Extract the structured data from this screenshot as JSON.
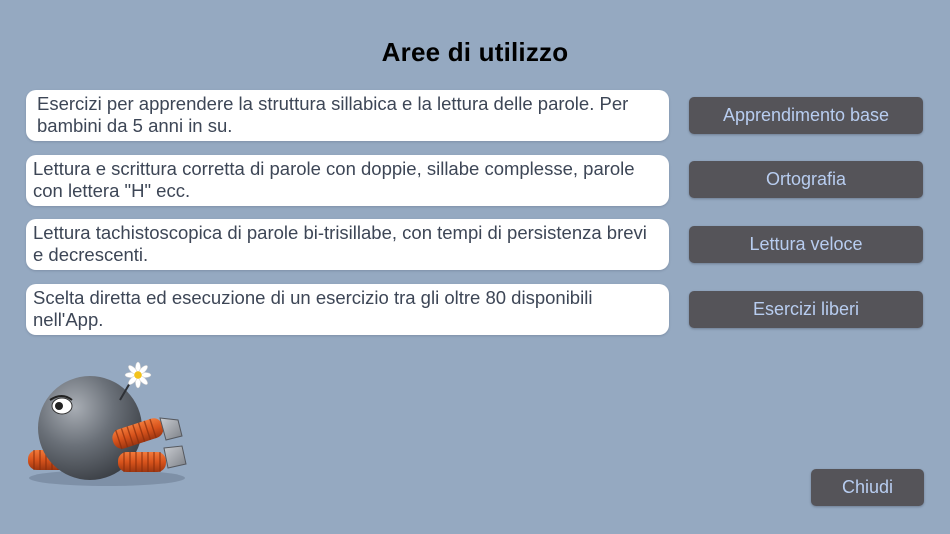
{
  "page": {
    "title": "Aree di utilizzo"
  },
  "areas": [
    {
      "description": "Esercizi per apprendere la struttura sillabica e la lettura  delle parole. Per bambini da 5 anni in su.",
      "button_label": "Apprendimento base"
    },
    {
      "description": "Lettura e scrittura corretta di parole con doppie, sillabe complesse, parole con lettera \"H\" ecc.",
      "button_label": "Ortografia"
    },
    {
      "description": "Lettura tachistoscopica di parole bi-trisillabe, con tempi di persistenza brevi e decrescenti.",
      "button_label": "Lettura veloce"
    },
    {
      "description": "Scelta diretta ed esecuzione di un esercizio tra gli oltre 80 disponibili nell'App.",
      "button_label": "Esercizi liberi"
    }
  ],
  "footer": {
    "close_label": "Chiudi"
  },
  "mascot": {
    "icon": "robot-ball-mascot-with-daisy",
    "colors": {
      "body": "#6a7078",
      "coils": "#d8531c",
      "flower_center": "#f3c21a"
    }
  },
  "colors": {
    "background": "#95a9c1",
    "card": "#ffffff",
    "card_text": "#3d4656",
    "button_bg": "#555459",
    "button_text": "#b8cdf0"
  }
}
